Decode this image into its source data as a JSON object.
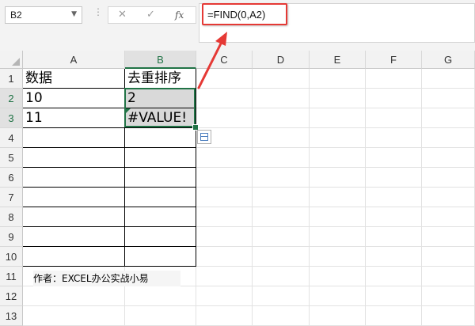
{
  "namebox": {
    "value": "B2"
  },
  "formula_bar": {
    "cancel_glyph": "✕",
    "enter_glyph": "✓",
    "fx_label": "fx",
    "formula": "=FIND(0,A2)"
  },
  "columns": [
    "A",
    "B",
    "C",
    "D",
    "E",
    "F",
    "G"
  ],
  "rows": [
    "1",
    "2",
    "3",
    "4",
    "5",
    "6",
    "7",
    "8",
    "9",
    "10",
    "11",
    "12",
    "13"
  ],
  "cells": {
    "A1": "数据",
    "B1": "去重排序",
    "A2": "10",
    "B2": "2",
    "A3": "11",
    "B3": "#VALUE!"
  },
  "author": "作者：EXCEL办公实战小易",
  "colors": {
    "selection": "#217346",
    "annotation": "#e53935"
  }
}
